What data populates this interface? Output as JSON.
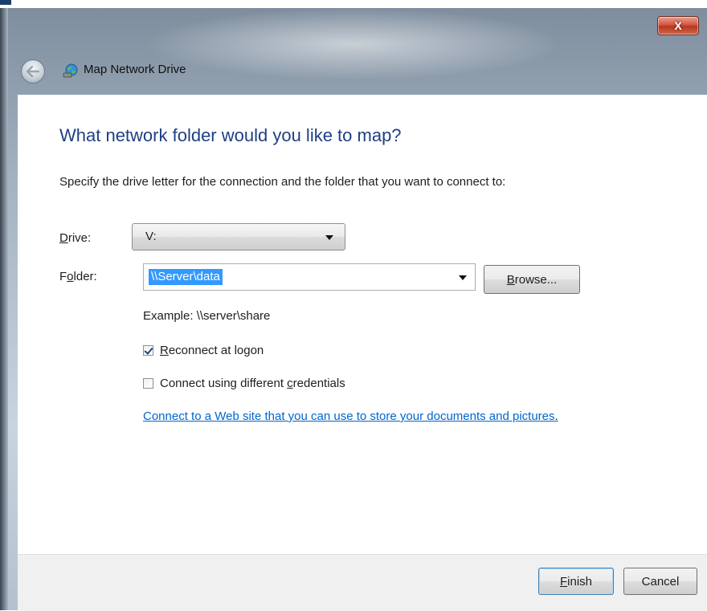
{
  "window": {
    "title": "Map Network Drive",
    "close_label": "X"
  },
  "main": {
    "heading": "What network folder would you like to map?",
    "instruction": "Specify the drive letter for the connection and the folder that you want to connect to:",
    "drive": {
      "label_pre": "",
      "label_mnemonic": "D",
      "label_post": "rive:",
      "value": "V:"
    },
    "folder": {
      "label_pre": "F",
      "label_mnemonic": "o",
      "label_post": "lder:",
      "value": "\\\\Server\\data"
    },
    "browse": {
      "mnemonic": "B",
      "rest": "rowse..."
    },
    "example": "Example: \\\\server\\share",
    "reconnect": {
      "pre": "",
      "mnemonic": "R",
      "post": "econnect at logon",
      "checked": true
    },
    "credentials": {
      "pre": "Connect using different ",
      "mnemonic": "c",
      "post": "redentials",
      "checked": false
    },
    "link_text": "Connect to a Web site that you can use to store your documents and pictures",
    "link_suffix": "."
  },
  "footer": {
    "finish": {
      "mnemonic": "F",
      "rest": "inish"
    },
    "cancel": "Cancel"
  },
  "colors": {
    "heading": "#1e3f86",
    "link": "#0066cc",
    "selection": "#3399ff"
  },
  "icons": [
    "back-arrow-icon",
    "network-drive-icon",
    "close-icon",
    "chevron-down-icon",
    "checkmark-icon"
  ]
}
